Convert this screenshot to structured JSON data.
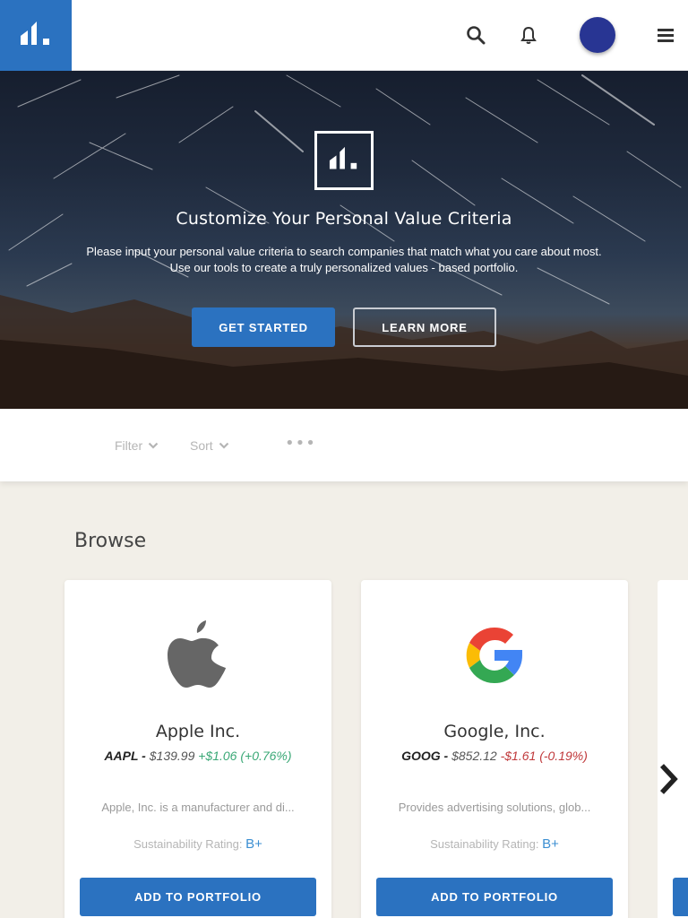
{
  "header": {
    "brand_icon": "brand-logo-icon",
    "icons": [
      "search-icon",
      "bell-icon",
      "menu-icon"
    ],
    "avatar_color": "#283593",
    "brand_color": "#2b72c0"
  },
  "hero": {
    "title": "Customize Your Personal Value Criteria",
    "subtitle_line1": "Please input your personal value criteria to search companies that match what you care about most.",
    "subtitle_line2": "Use our tools to create a truly personalized values - based portfolio.",
    "primary_button": "GET STARTED",
    "secondary_button": "LEARN MORE"
  },
  "filters": {
    "filter_label": "Filter",
    "sort_label": "Sort",
    "more_label": "•••"
  },
  "browse": {
    "title": "Browse",
    "cards": [
      {
        "name": "Apple Inc.",
        "ticker": "AAPL -",
        "price": "$139.99",
        "change": "+$1.06 (+0.76%)",
        "change_direction": "up",
        "description": "Apple, Inc. is a manufacturer and di...",
        "rating_label": "Sustainability Rating:",
        "rating": "B+",
        "button": "ADD TO PORTFOLIO",
        "logo_icon": "apple-logo-icon"
      },
      {
        "name": "Google, Inc.",
        "ticker": "GOOG -",
        "price": "$852.12",
        "change": "-$1.61 (-0.19%)",
        "change_direction": "down",
        "description": "Provides advertising solutions, glob...",
        "rating_label": "Sustainability Rating:",
        "rating": "B+",
        "button": "ADD TO PORTFOLIO",
        "logo_icon": "google-logo-icon"
      }
    ],
    "next_icon": "chevron-right-icon"
  },
  "colors": {
    "positive": "#3aa876",
    "negative": "#c0393b",
    "rating": "#3c8fd2"
  }
}
